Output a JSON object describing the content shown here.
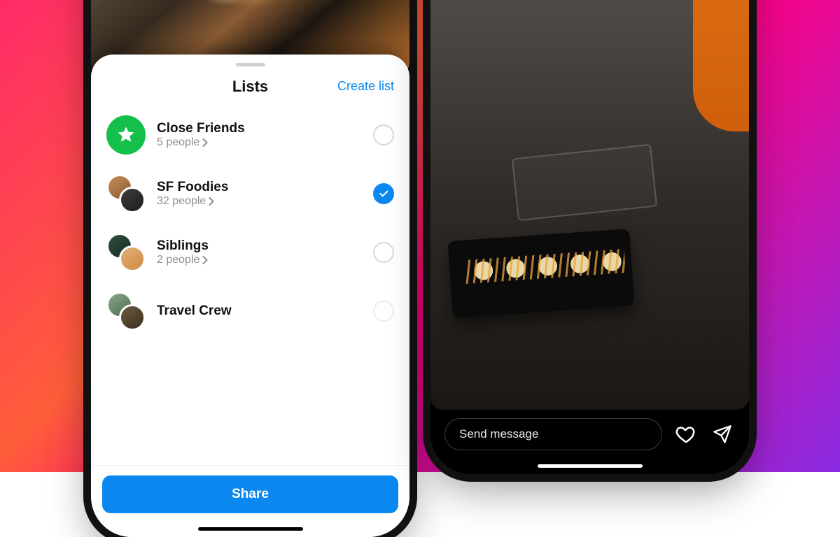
{
  "colors": {
    "accent": "#0b88ef",
    "closeFriends": "#14c04a"
  },
  "sheet": {
    "title": "Lists",
    "create_label": "Create list",
    "share_label": "Share",
    "items": [
      {
        "name": "Close Friends",
        "sub": "5 people",
        "icon": "star",
        "selected": false
      },
      {
        "name": "SF Foodies",
        "sub": "32 people",
        "icon": "stack-sf",
        "selected": true
      },
      {
        "name": "Siblings",
        "sub": "2 people",
        "icon": "stack-sib",
        "selected": false
      },
      {
        "name": "Travel Crew",
        "sub": "",
        "icon": "stack-trav",
        "selected": false
      }
    ]
  },
  "story": {
    "message_placeholder": "Send message"
  }
}
